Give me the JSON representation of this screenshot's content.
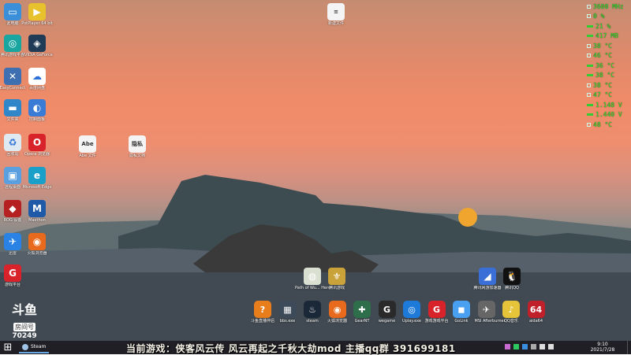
{
  "desktop_icons": [
    {
      "label": "此电脑",
      "color": "#3b8fd8",
      "glyph": "▭"
    },
    {
      "label": "PotPlayer 64 bit",
      "color": "#e7c22d",
      "glyph": "▶"
    },
    {
      "label": "腾讯游戏平台",
      "color": "#1aa6a0",
      "glyph": "◎"
    },
    {
      "label": "NVIDIA GeForce",
      "color": "#203b56",
      "glyph": "◈"
    },
    {
      "label": "EasyConnect",
      "color": "#3e6fb0",
      "glyph": "✕"
    },
    {
      "label": "百度网盘",
      "color": "#ffffff",
      "glyph": "☁"
    },
    {
      "label": "文件夹",
      "color": "#2f86c9",
      "glyph": "▬"
    },
    {
      "label": "控制面板",
      "color": "#3a7bd5",
      "glyph": "◐"
    },
    {
      "label": "回收站",
      "color": "#dfe9f1",
      "glyph": "♻"
    },
    {
      "label": "Opera 浏览器",
      "color": "#d8232a",
      "glyph": "O"
    },
    {
      "label": "远程桌面",
      "color": "#5aa0e0",
      "glyph": "▣"
    },
    {
      "label": "Microsoft Edge",
      "color": "#1aa0c8",
      "glyph": "e"
    },
    {
      "label": "ROG 设置",
      "color": "#b52020",
      "glyph": "◆"
    },
    {
      "label": "Maxthon",
      "color": "#1e5aa8",
      "glyph": "M"
    },
    {
      "label": "迅雷",
      "color": "#2a82e4",
      "glyph": "✈"
    },
    {
      "label": "火狐浏览器",
      "color": "#e86a1c",
      "glyph": "◉"
    },
    {
      "label": "游戏平台",
      "color": "#d8232a",
      "glyph": "G"
    }
  ],
  "file_icons": [
    {
      "label": "新建文件",
      "glyph": "≡"
    },
    {
      "label": "Abe 文件",
      "glyph": "Abe"
    },
    {
      "label": "隐私文档",
      "glyph": "隐私"
    }
  ],
  "mid_icons": [
    {
      "label": "Path of Wu... Heroes 12",
      "color": "#d9e0d2",
      "glyph": "◍"
    },
    {
      "label": "腾讯游戏",
      "color": "#caa23a",
      "glyph": "⚜"
    }
  ],
  "right_icons": [
    {
      "label": "腾讯网游加速器",
      "color": "#3a6fd8",
      "glyph": "◢"
    },
    {
      "label": "腾讯QQ",
      "color": "#111111",
      "glyph": "🐧"
    }
  ],
  "dock": [
    {
      "label": "斗鱼直播伴侣",
      "color": "#e87d1c",
      "glyph": "?"
    },
    {
      "label": "bbs.exe",
      "color": "#3c4a5a",
      "glyph": "▦"
    },
    {
      "label": "steam",
      "color": "#1b2838",
      "glyph": "♨"
    },
    {
      "label": "火狐浏览器",
      "color": "#e86a1c",
      "glyph": "◉"
    },
    {
      "label": "GearNT",
      "color": "#2f6e4a",
      "glyph": "✚"
    },
    {
      "label": "wegame",
      "color": "#2a2a2a",
      "glyph": "G"
    },
    {
      "label": "Uplay.exe",
      "color": "#1e7ad8",
      "glyph": "◎"
    },
    {
      "label": "游戏游戏平台",
      "color": "#d8232a",
      "glyph": "G"
    },
    {
      "label": "GoLink",
      "color": "#49a0f0",
      "glyph": "◼"
    },
    {
      "label": "MSI Afterburner",
      "color": "#666666",
      "glyph": "✈"
    },
    {
      "label": "QQ音乐",
      "color": "#e6c43a",
      "glyph": "♪"
    },
    {
      "label": "aida64",
      "color": "#c0202a",
      "glyph": "64"
    }
  ],
  "hw_monitor": [
    {
      "kind": "dot",
      "value": "3600 MHz"
    },
    {
      "kind": "dot",
      "value": "0 %"
    },
    {
      "kind": "bar",
      "value": "21 %"
    },
    {
      "kind": "bar",
      "value": "417 MB"
    },
    {
      "kind": "dot",
      "value": "38 °C"
    },
    {
      "kind": "dot",
      "value": "46 °C"
    },
    {
      "kind": "bar",
      "value": "36 °C"
    },
    {
      "kind": "bar",
      "value": "38 °C"
    },
    {
      "kind": "dot",
      "value": "38 °C"
    },
    {
      "kind": "dot",
      "value": "47 °C"
    },
    {
      "kind": "bar",
      "value": "1.148 V"
    },
    {
      "kind": "bar",
      "value": "1.440 V"
    },
    {
      "kind": "dot",
      "value": "48 °C"
    }
  ],
  "watermark": {
    "logo": "斗鱼",
    "line": "房间号",
    "room": "70249"
  },
  "taskbar": {
    "start_glyph": "⊞",
    "steam_label": "Steam",
    "caption": "当前游戏：侠客风云传 风云再起之千秋大劫mod 主播qq群 391699181",
    "clock_time": "9:10",
    "clock_date": "2021/7/28"
  }
}
